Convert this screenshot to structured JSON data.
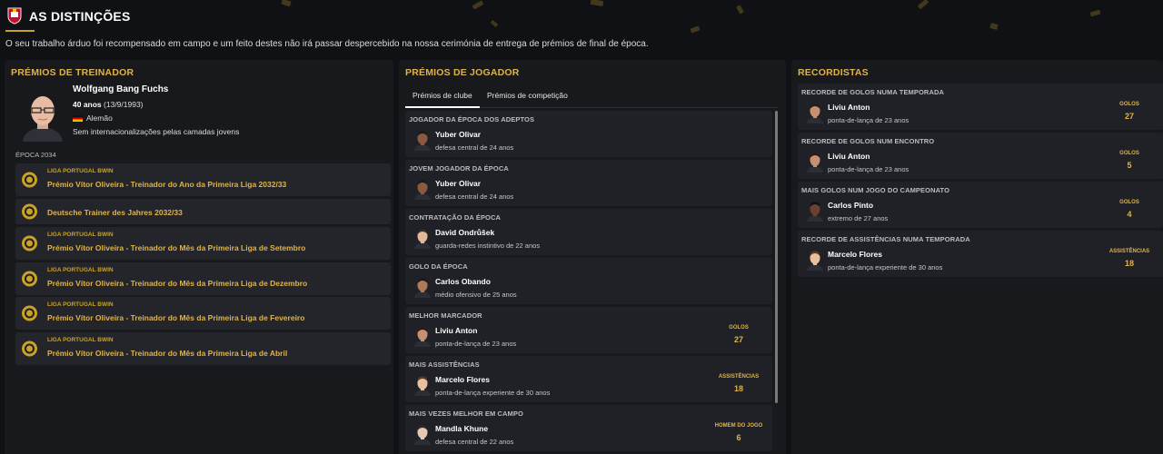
{
  "header": {
    "title": "AS DISTINÇÕES",
    "subtitle": "O seu trabalho árduo foi recompensado em campo e um feito destes não irá passar despercebido na nossa cerimónia de entrega de prémios de final de época."
  },
  "colors": {
    "accent": "#e0b34a",
    "background": "#101115",
    "panel": "#18191d",
    "row": "#202126"
  },
  "coach_panel": {
    "title": "PRÉMIOS DE TREINADOR",
    "name": "Wolfgang Bang Fuchs",
    "age": "40 anos",
    "birth": "(13/9/1993)",
    "nationality": "Alemão",
    "caps": "Sem internacionalizações pelas camadas jovens",
    "season": "ÉPOCA 2034",
    "awards": [
      {
        "competition": "LIGA PORTUGAL BWIN",
        "name": "Prémio Vítor Oliveira - Treinador do Ano da Primeira Liga 2032/33"
      },
      {
        "competition": "",
        "name": "Deutsche Trainer des Jahres 2032/33"
      },
      {
        "competition": "LIGA PORTUGAL BWIN",
        "name": "Prémio Vítor Oliveira - Treinador do Mês da Primeira Liga de Setembro"
      },
      {
        "competition": "LIGA PORTUGAL BWIN",
        "name": "Prémio Vítor Oliveira - Treinador do Mês da Primeira Liga de Dezembro"
      },
      {
        "competition": "LIGA PORTUGAL BWIN",
        "name": "Prémio Vítor Oliveira - Treinador do Mês da Primeira Liga de Fevereiro"
      },
      {
        "competition": "LIGA PORTUGAL BWIN",
        "name": "Prémio Vítor Oliveira - Treinador do Mês da Primeira Liga de Abril"
      }
    ]
  },
  "player_panel": {
    "title": "PRÉMIOS DE JOGADOR",
    "tabs": [
      "Prémios de clube",
      "Prémios de competição"
    ],
    "awards": [
      {
        "title": "JOGADOR DA ÉPOCA DOS ADEPTOS",
        "player": "Yuber Olivar",
        "desc": "defesa central de 24 anos",
        "stat_label": "",
        "stat_value": ""
      },
      {
        "title": "JOVEM JOGADOR DA ÉPOCA",
        "player": "Yuber Olivar",
        "desc": "defesa central de 24 anos",
        "stat_label": "",
        "stat_value": ""
      },
      {
        "title": "CONTRATAÇÃO DA ÉPOCA",
        "player": "David Ondrůšek",
        "desc": "guarda-redes instintivo de 22 anos",
        "stat_label": "",
        "stat_value": ""
      },
      {
        "title": "GOLO DA ÉPOCA",
        "player": "Carlos Obando",
        "desc": "médio ofensivo de 25 anos",
        "stat_label": "",
        "stat_value": ""
      },
      {
        "title": "MELHOR MARCADOR",
        "player": "Liviu Anton",
        "desc": "ponta-de-lança de 23 anos",
        "stat_label": "GOLOS",
        "stat_value": "27"
      },
      {
        "title": "MAIS ASSISTÊNCIAS",
        "player": "Marcelo Flores",
        "desc": "ponta-de-lança experiente de 30 anos",
        "stat_label": "ASSISTÊNCIAS",
        "stat_value": "18"
      },
      {
        "title": "MAIS VEZES MELHOR EM CAMPO",
        "player": "Mandla Khune",
        "desc": "defesa central de 22 anos",
        "stat_label": "HOMEM DO JOGO",
        "stat_value": "6"
      }
    ]
  },
  "records_panel": {
    "title": "RECORDISTAS",
    "records": [
      {
        "title": "RECORDE DE GOLOS NUMA TEMPORADA",
        "player": "Liviu Anton",
        "desc": "ponta-de-lança de 23 anos",
        "stat_label": "GOLOS",
        "stat_value": "27"
      },
      {
        "title": "RECORDE DE GOLOS NUM ENCONTRO",
        "player": "Liviu Anton",
        "desc": "ponta-de-lança de 23 anos",
        "stat_label": "GOLOS",
        "stat_value": "5"
      },
      {
        "title": "MAIS GOLOS NUM JOGO DO CAMPEONATO",
        "player": "Carlos Pinto",
        "desc": "extremo de 27 anos",
        "stat_label": "GOLOS",
        "stat_value": "4"
      },
      {
        "title": "RECORDE DE ASSISTÊNCIAS NUMA TEMPORADA",
        "player": "Marcelo Flores",
        "desc": "ponta-de-lança experiente de 30 anos",
        "stat_label": "ASSISTÊNCIAS",
        "stat_value": "18"
      }
    ]
  }
}
